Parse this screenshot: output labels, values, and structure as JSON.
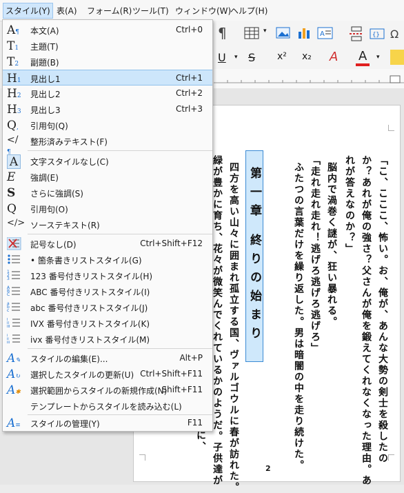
{
  "menubar": [
    "スタイル(Y)",
    "表(A)",
    "フォーム(R)",
    "ツール(T)",
    "ウィンドウ(W)",
    "ヘルプ(H)"
  ],
  "menu": {
    "group1": [
      {
        "label": "本文(A)",
        "shortcut": "Ctrl+0",
        "icon": "body-text-icon"
      },
      {
        "label": "主題(T)",
        "shortcut": "",
        "icon": "title-icon"
      },
      {
        "label": "副題(B)",
        "shortcut": "",
        "icon": "subtitle-icon"
      },
      {
        "label": "見出し1",
        "shortcut": "Ctrl+1",
        "icon": "heading1-icon"
      },
      {
        "label": "見出し2",
        "shortcut": "Ctrl+2",
        "icon": "heading2-icon"
      },
      {
        "label": "見出し3",
        "shortcut": "Ctrl+3",
        "icon": "heading3-icon"
      },
      {
        "label": "引用句(Q)",
        "shortcut": "",
        "icon": "quotation-icon"
      },
      {
        "label": "整形済みテキスト(F)",
        "shortcut": "",
        "icon": "preformatted-icon"
      }
    ],
    "group2": [
      {
        "label": "文字スタイルなし(C)",
        "shortcut": "",
        "icon": "no-char-style-icon"
      },
      {
        "label": "強調(E)",
        "shortcut": "",
        "icon": "emphasis-icon"
      },
      {
        "label": "さらに強調(S)",
        "shortcut": "",
        "icon": "strong-emphasis-icon"
      },
      {
        "label": "引用句(O)",
        "shortcut": "",
        "icon": "quote-icon"
      },
      {
        "label": "ソーステキスト(R)",
        "shortcut": "",
        "icon": "source-text-icon"
      }
    ],
    "group3": [
      {
        "label": "記号なし(D)",
        "shortcut": "Ctrl+Shift+F12",
        "icon": "no-list-icon"
      },
      {
        "label": "• 箇条書きリストスタイル(G)",
        "shortcut": "",
        "icon": "bullet-list-icon"
      },
      {
        "label": "123 番号付きリストスタイル(H)",
        "shortcut": "",
        "icon": "numbered-list-icon"
      },
      {
        "label": "ABC 番号付きリストスタイル(I)",
        "shortcut": "",
        "icon": "alpha-upper-list-icon"
      },
      {
        "label": "abc 番号付きリストスタイル(J)",
        "shortcut": "",
        "icon": "alpha-lower-list-icon"
      },
      {
        "label": "IVX 番号付きリストスタイル(K)",
        "shortcut": "",
        "icon": "roman-upper-list-icon"
      },
      {
        "label": "ivx 番号付きリストスタイル(M)",
        "shortcut": "",
        "icon": "roman-lower-list-icon"
      }
    ],
    "group4": [
      {
        "label": "スタイルの編集(E)...",
        "shortcut": "Alt+P",
        "icon": "edit-style-icon"
      },
      {
        "label": "選択したスタイルの更新(U)",
        "shortcut": "Ctrl+Shift+F11",
        "icon": "update-style-icon"
      },
      {
        "label": "選択範囲からスタイルの新規作成(N)",
        "shortcut": "Shift+F11",
        "icon": "new-style-icon"
      },
      {
        "label": "テンプレートからスタイルを読み込む(L)",
        "shortcut": "",
        "icon": "load-styles-icon"
      }
    ],
    "group5": [
      {
        "label": "スタイルの管理(Y)",
        "shortcut": "F11",
        "icon": "manage-styles-icon"
      }
    ]
  },
  "document": {
    "columns": [
      "「こ、こここ、怖い。お、俺が、あんな大勢の剣士を殺したの",
      "か？あれが俺の強さ？父さんが俺を鍛えてくれなくなった理由。あ",
      "れが答えなのか？」",
      "脳内で渦巻く謎が、狂い暴れる。",
      "「走れ走れ走れ！逃げろ逃げろ逃げろ」",
      "ふたつの言葉だけを繰り返した。男は暗闇の中を走り続けた。"
    ],
    "chapter_title": "第一章 終りの始まり",
    "body_columns": [
      "四方を高い山々に囲まれ孤立する国、ヴァルゴウルに春が訪れた。",
      "緑が豊かに育ち、花々が微笑んでくれているかのようだ。子供達が",
      "に、"
    ],
    "page_number": "2"
  },
  "colors": {
    "highlight": "#cde6fb",
    "accent": "#1a6fd1",
    "font_color_bar": "#e02020"
  }
}
